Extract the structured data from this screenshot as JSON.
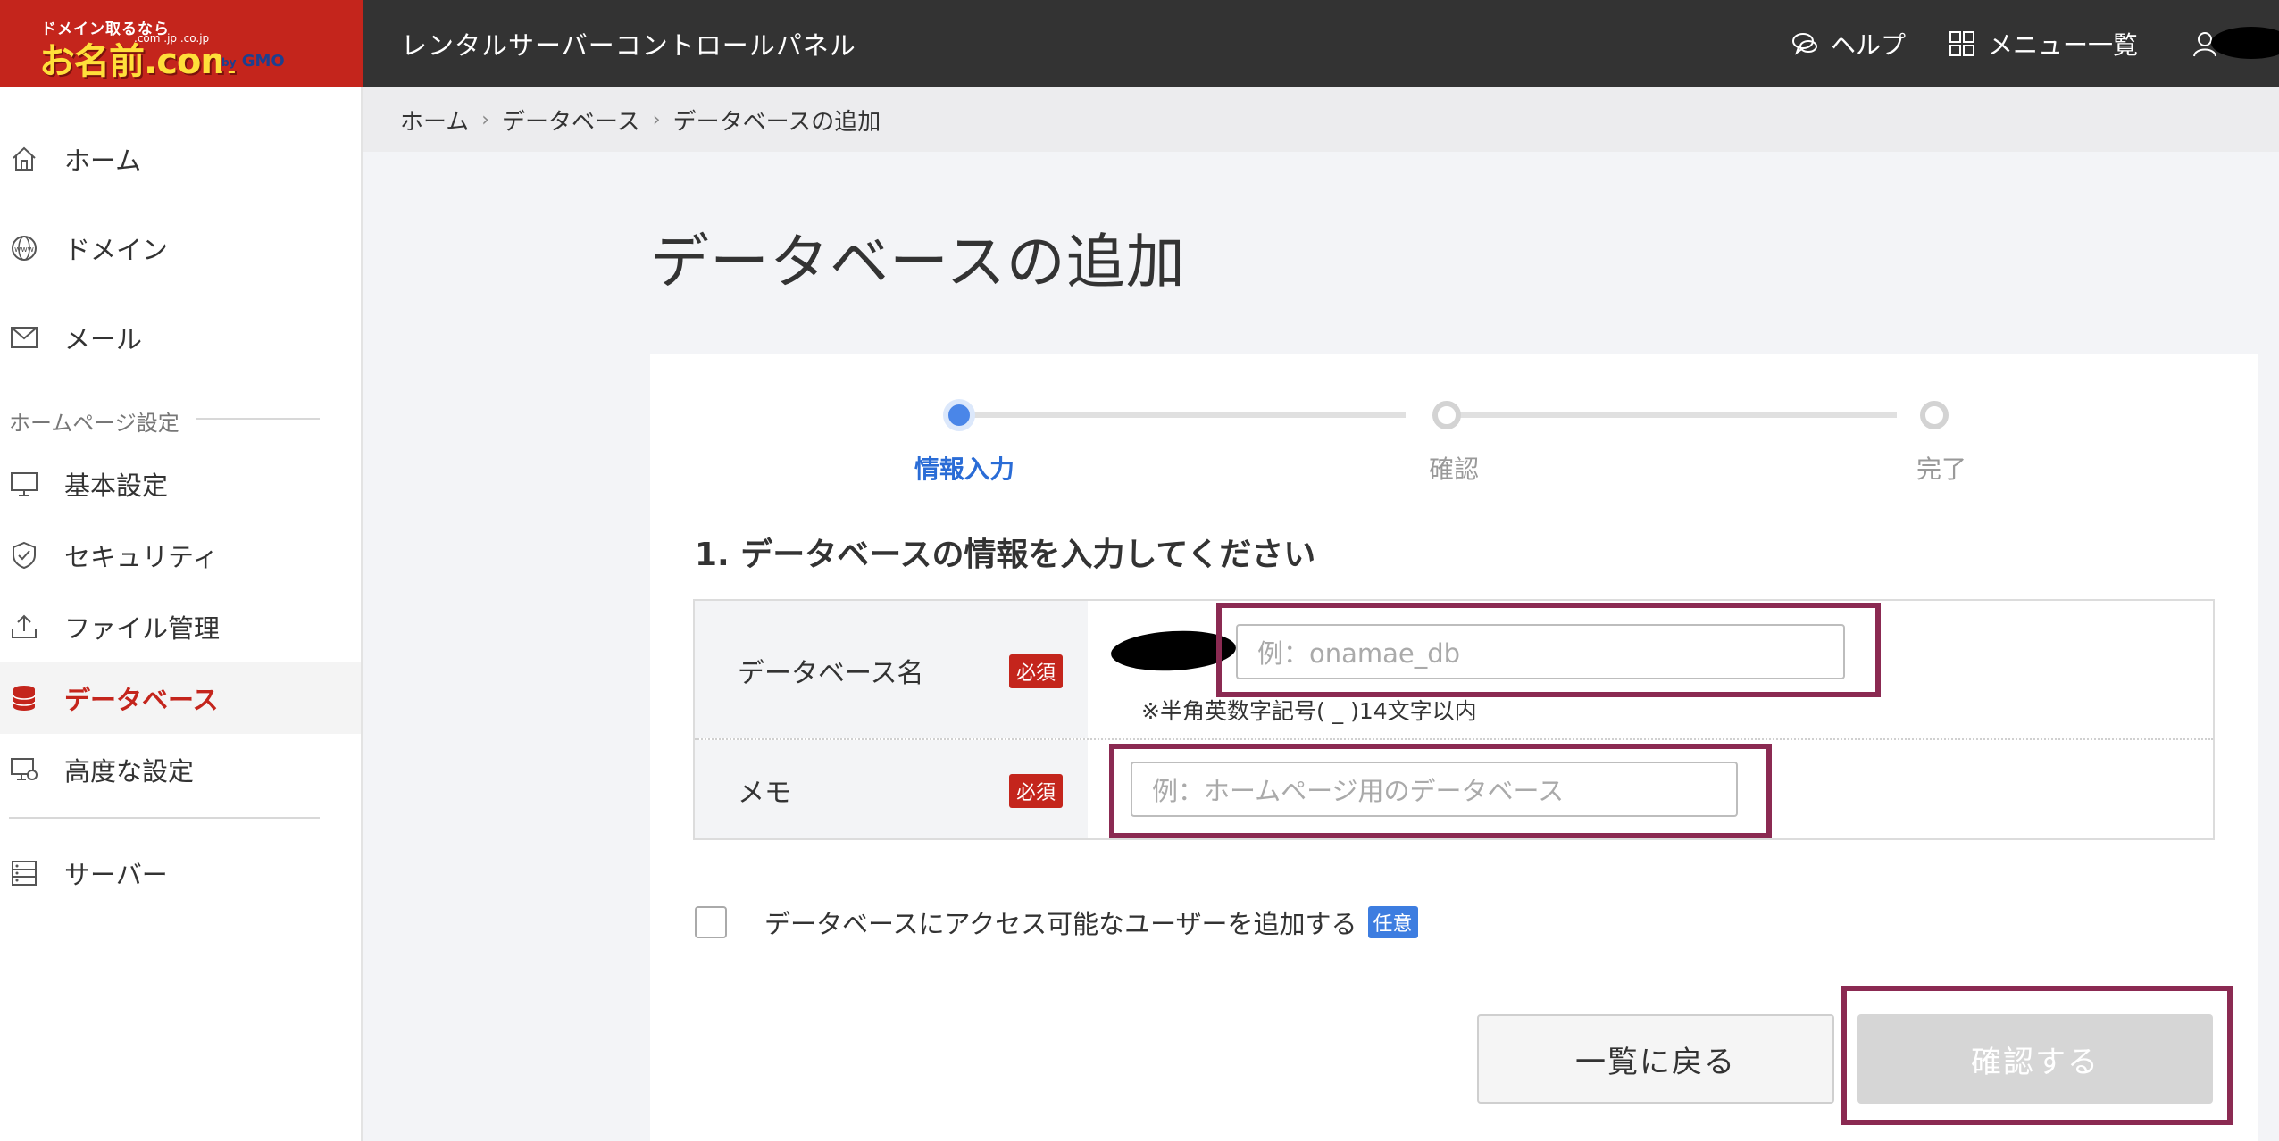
{
  "header": {
    "logo": {
      "tagline": "ドメイン取るなら",
      "brand": "お名前.com",
      "tlds": ".com .jp .co.jp",
      "by": "by",
      "company": "GMO"
    },
    "app_title": "レンタルサーバーコントロールパネル",
    "help_label": "ヘルプ",
    "menu_label": "メニュー一覧"
  },
  "sidebar": {
    "items": [
      {
        "label": "ホーム",
        "icon": "home-icon"
      },
      {
        "label": "ドメイン",
        "icon": "globe-icon"
      },
      {
        "label": "メール",
        "icon": "mail-icon"
      }
    ],
    "section_label": "ホームページ設定",
    "section_items": [
      {
        "label": "基本設定",
        "icon": "monitor-icon"
      },
      {
        "label": "セキュリティ",
        "icon": "shield-icon"
      },
      {
        "label": "ファイル管理",
        "icon": "upload-icon"
      },
      {
        "label": "データベース",
        "icon": "database-icon",
        "active": true
      },
      {
        "label": "高度な設定",
        "icon": "monitor-gear-icon"
      }
    ],
    "bottom_items": [
      {
        "label": "サーバー",
        "icon": "server-icon"
      }
    ]
  },
  "breadcrumb": [
    "ホーム",
    "データベース",
    "データベースの追加"
  ],
  "page_title": "データベースの追加",
  "stepper": {
    "steps": [
      "情報入力",
      "確認",
      "完了"
    ],
    "current": 0
  },
  "form": {
    "heading": "1. データベースの情報を入力してください",
    "db_name": {
      "label": "データベース名",
      "required": "必須",
      "placeholder": "例：onamae_db",
      "hint": "※半角英数字記号( _ )14文字以内"
    },
    "memo": {
      "label": "メモ",
      "required": "必須",
      "placeholder": "例：ホームページ用のデータベース"
    },
    "add_user": {
      "label": "データベースにアクセス可能なユーザーを追加する",
      "badge": "任意",
      "checked": false
    }
  },
  "buttons": {
    "back": "一覧に戻る",
    "confirm": "確認する"
  },
  "colors": {
    "brand_red": "#c4251c",
    "header_bg": "#333333",
    "accent_blue": "#4a86e8",
    "highlight": "#8b2a52"
  }
}
